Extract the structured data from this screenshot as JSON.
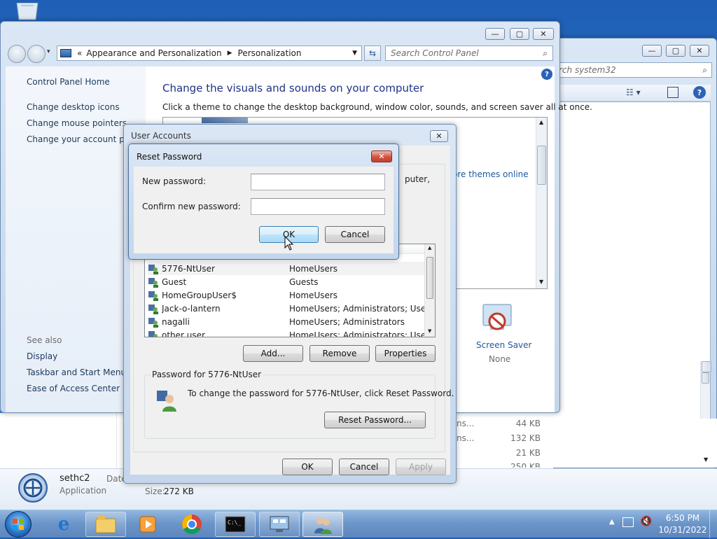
{
  "sys32": {
    "search_placeholder": "rch system32",
    "files": [
      {
        "type": "ns...",
        "size": "44 KB"
      },
      {
        "type": "ns...",
        "size": "132 KB"
      },
      {
        "type": "",
        "size": "21 KB"
      },
      {
        "type": "",
        "size": "250 KB"
      }
    ]
  },
  "control_panel": {
    "breadcrumb": [
      "Appearance and Personalization",
      "Personalization"
    ],
    "search_placeholder": "Search Control Panel",
    "sidebar": {
      "home": "Control Panel Home",
      "links": [
        "Change desktop icons",
        "Change mouse pointers",
        "Change your account pict"
      ],
      "see_also_title": "See also",
      "see_also": [
        "Display",
        "Taskbar and Start Menu",
        "Ease of Access Center"
      ]
    },
    "heading": "Change the visuals and sounds on your computer",
    "description": "Click a theme to change the desktop background, window color, sounds, and screen saver all at once.",
    "more_themes": "ore themes online",
    "screen_saver_label": "Screen Saver",
    "screen_saver_value": "None"
  },
  "details": {
    "name": "sethc2",
    "type": "Application",
    "date_label": "Date",
    "size_label": "Size:",
    "size_value": "272 KB"
  },
  "user_accounts": {
    "title": "User Accounts",
    "partial_text": "puter,",
    "users": [
      {
        "name": "5776-NtUser",
        "group": "HomeUsers"
      },
      {
        "name": "Guest",
        "group": "Guests"
      },
      {
        "name": "HomeGroupUser$",
        "group": "HomeUsers"
      },
      {
        "name": "Jack-o-lantern",
        "group": "HomeUsers; Administrators; Users"
      },
      {
        "name": "nagalli",
        "group": "HomeUsers; Administrators"
      },
      {
        "name": "other user",
        "group": "HomeUsers; Administrators; Users"
      }
    ],
    "add": "Add...",
    "remove": "Remove",
    "properties": "Properties",
    "group_title": "Password for 5776-NtUser",
    "group_text": "To change the password for 5776-NtUser, click Reset Password.",
    "reset": "Reset Password...",
    "ok": "OK",
    "cancel": "Cancel",
    "apply": "Apply"
  },
  "reset_password": {
    "title": "Reset Password",
    "new_label": "New password:",
    "confirm_label": "Confirm new password:",
    "new_value": "",
    "confirm_value": "",
    "ok": "OK",
    "cancel": "Cancel"
  },
  "taskbar": {
    "items": [
      "start-orb",
      "internet-explorer",
      "file-explorer",
      "media-player",
      "chrome",
      "command-prompt",
      "control-panel",
      "user-accounts"
    ],
    "time": "6:50 PM",
    "date": "10/31/2022"
  }
}
